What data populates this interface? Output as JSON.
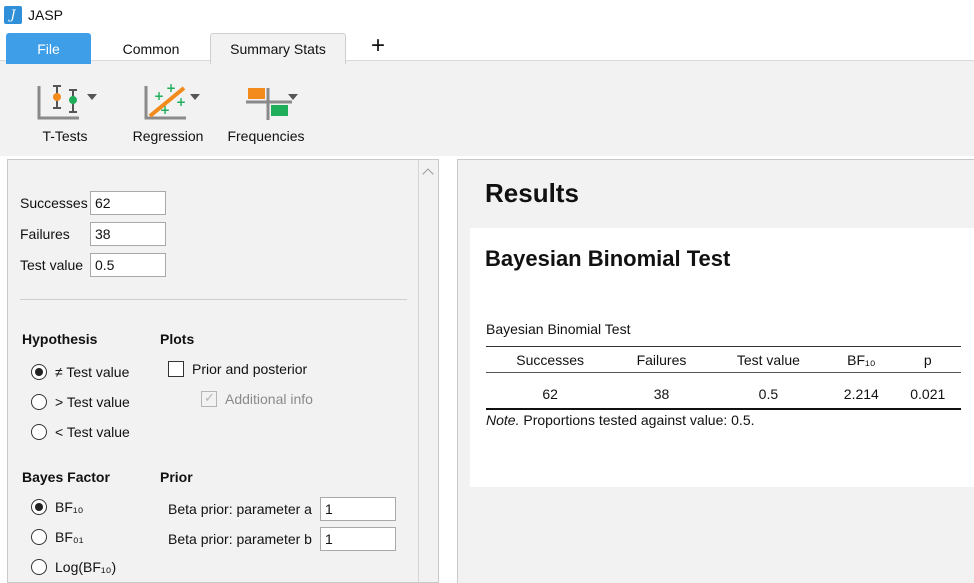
{
  "app": {
    "title": "JASP",
    "logo_glyph": "J"
  },
  "tabs": {
    "file": "File",
    "common": "Common",
    "summary": "Summary Stats",
    "add": "+"
  },
  "ribbon": {
    "ttests": "T-Tests",
    "regression": "Regression",
    "frequencies": "Frequencies"
  },
  "options": {
    "successes": {
      "label": "Successes",
      "value": "62"
    },
    "failures": {
      "label": "Failures",
      "value": "38"
    },
    "test_value": {
      "label": "Test value",
      "value": "0.5"
    },
    "hypothesis": {
      "title": "Hypothesis",
      "items": [
        "≠ Test value",
        "> Test value",
        "< Test value"
      ],
      "selected": 0
    },
    "plots": {
      "title": "Plots",
      "prior_posterior": "Prior and posterior",
      "additional_info": "Additional info"
    },
    "bayes_factor": {
      "title": "Bayes Factor",
      "items": [
        "BF₁₀",
        "BF₀₁",
        "Log(BF₁₀)"
      ],
      "selected": 0
    },
    "prior": {
      "title": "Prior",
      "param_a_label": "Beta prior: parameter a",
      "param_a_value": "1",
      "param_b_label": "Beta prior: parameter b",
      "param_b_value": "1"
    }
  },
  "results": {
    "heading": "Results",
    "analysis_title": "Bayesian Binomial Test",
    "table_caption": "Bayesian Binomial Test",
    "columns": [
      "Successes",
      "Failures",
      "Test value",
      "BF₁₀",
      "p"
    ],
    "row": [
      "62",
      "38",
      "0.5",
      "2.214",
      "0.021"
    ],
    "note_label": "Note.",
    "note_text": " Proportions tested against value: 0.5."
  },
  "colors": {
    "file_tab": "#3f9ee8",
    "panel_bg": "#f2f2f2",
    "icon_orange": "#f28a1c",
    "icon_green": "#1fae5a"
  }
}
